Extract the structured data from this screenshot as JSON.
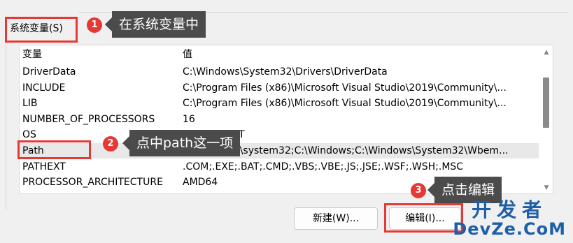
{
  "group": {
    "label": "系统变量(S)"
  },
  "list": {
    "header": {
      "name": "变量",
      "value": "值"
    },
    "rows": [
      {
        "name": "DriverData",
        "value": "C:\\Windows\\System32\\Drivers\\DriverData"
      },
      {
        "name": "INCLUDE",
        "value": "C:\\Program Files (x86)\\Microsoft Visual Studio\\2019\\Community\\..."
      },
      {
        "name": "LIB",
        "value": "C:\\Program Files (x86)\\Microsoft Visual Studio\\2019\\Community\\..."
      },
      {
        "name": "NUMBER_OF_PROCESSORS",
        "value": "16"
      },
      {
        "name": "OS",
        "value": "Windows_NT"
      },
      {
        "name": "Path",
        "value": "C:\\Windows\\system32;C:\\Windows;C:\\Windows\\System32\\Wbem..."
      },
      {
        "name": "PATHEXT",
        "value": ".COM;.EXE;.BAT;.CMD;.VBS;.VBE;.JS;.JSE;.WSF;.WSH;.MSC"
      },
      {
        "name": "PROCESSOR_ARCHITECTURE",
        "value": "AMD64"
      }
    ],
    "selected_index": 5
  },
  "buttons": {
    "new": "新建(W)...",
    "edit": "编辑(I)..."
  },
  "annotations": [
    {
      "number": "1",
      "text": "在系统变量中"
    },
    {
      "number": "2",
      "text": "点中path这一项"
    },
    {
      "number": "3",
      "text": "点击编辑"
    }
  ],
  "watermark": {
    "line1": "开发者",
    "line2": "DevZe.CoM"
  },
  "colors": {
    "highlight": "#e53935",
    "tooltip_bg": "#4b4b4b",
    "watermark": "#1f5fa8"
  }
}
